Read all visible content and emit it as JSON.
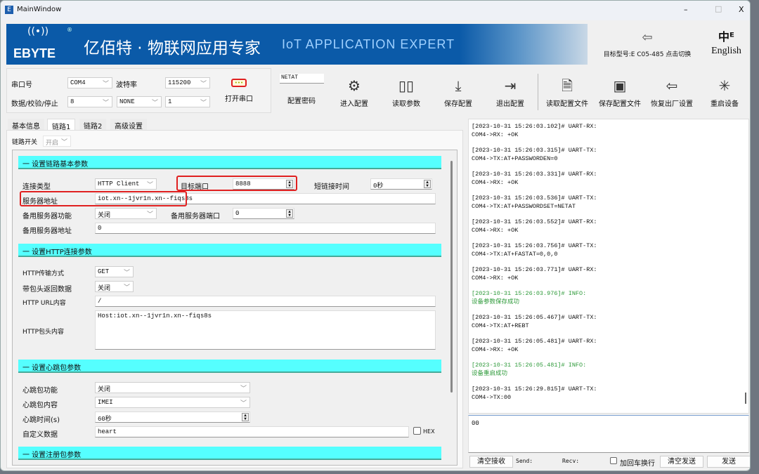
{
  "window": {
    "title": "MainWindow",
    "app_icon": "E",
    "minimize": "–",
    "maximize": "□",
    "close": "X"
  },
  "banner": {
    "logo": "EBYTE",
    "logo_mark": "®",
    "slogan_cn": "亿佰特 · 物联网应用专家",
    "slogan_en": "IoT APPLICATION EXPERT",
    "model_switch": "目标型号:E C05-485 点击切换",
    "language": "English"
  },
  "serial": {
    "port_label": "串口号",
    "port": "COM4",
    "baud_label": "波特率",
    "baud": "115200",
    "format_label": "数据/校验/停止",
    "data_bits": "8",
    "parity": "NONE",
    "stop_bits": "1",
    "open_label": "打开串口"
  },
  "toolbar": {
    "password_value": "NETAT",
    "password_label": "配置密码",
    "items": [
      "进入配置",
      "读取参数",
      "保存配置",
      "退出配置",
      "读取配置文件",
      "保存配置文件",
      "恢复出厂设置",
      "重启设备"
    ]
  },
  "tabs": [
    "基本信息",
    "链路1",
    "链路2",
    "高级设置"
  ],
  "link_switch": {
    "label": "链路开关",
    "value": "开启"
  },
  "basic": {
    "title": "一 设置链路基本参数",
    "conn_type_label": "连接类型",
    "conn_type": "HTTP Client",
    "port_label": "目标端口",
    "port": "8888",
    "short_label": "短链接时间",
    "short": "0秒",
    "server_label": "服务器地址",
    "server": "iot.xn--1jvr1n.xn--fiqs8s",
    "backup_func_label": "备用服务器功能",
    "backup_func": "关闭",
    "backup_port_label": "备用服务器端口",
    "backup_port": "0",
    "backup_addr_label": "备用服务器地址",
    "backup_addr": "0"
  },
  "http": {
    "title": "一 设置HTTP连接参数",
    "method_label": "HTTP传输方式",
    "method": "GET",
    "return_label": "带包头返回数据",
    "return": "关闭",
    "url_label": "HTTP URL内容",
    "url": "/",
    "header_label": "HTTP包头内容",
    "header": "Host:iot.xn--1jvr1n.xn--fiqs8s"
  },
  "heartbeat": {
    "title": "一 设置心跳包参数",
    "func_label": "心跳包功能",
    "func": "关闭",
    "content_label": "心跳包内容",
    "content": "IMEI",
    "time_label": "心跳时间(s)",
    "time": "60秒",
    "custom_label": "自定义数据",
    "custom": "heart",
    "hex": "HEX"
  },
  "register": {
    "title": "一 设置注册包参数"
  },
  "log": [
    {
      "h": "[2023-10-31 15:26:03.102]# UART-RX:",
      "b": "COM4->RX: +OK",
      "info": false
    },
    {
      "h": "[2023-10-31 15:26:03.315]# UART-TX:",
      "b": "COM4->TX:AT+PASSWORDEN=0",
      "info": false
    },
    {
      "h": "[2023-10-31 15:26:03.331]# UART-RX:",
      "b": "COM4->RX: +OK",
      "info": false
    },
    {
      "h": "[2023-10-31 15:26:03.536]# UART-TX:",
      "b": "COM4->TX:AT+PASSWORDSET=NETAT",
      "info": false
    },
    {
      "h": "[2023-10-31 15:26:03.552]# UART-RX:",
      "b": "COM4->RX: +OK",
      "info": false
    },
    {
      "h": "[2023-10-31 15:26:03.756]# UART-TX:",
      "b": "COM4->TX:AT+FASTAT=0,0,0",
      "info": false
    },
    {
      "h": "[2023-10-31 15:26:03.771]# UART-RX:",
      "b": "COM4->RX: +OK",
      "info": false
    },
    {
      "h": "[2023-10-31 15:26:03.976]# INFO:",
      "b": "设备参数保存成功",
      "info": true
    },
    {
      "h": "[2023-10-31 15:26:05.467]# UART-TX:",
      "b": "COM4->TX:AT+REBT",
      "info": false
    },
    {
      "h": "[2023-10-31 15:26:05.481]# UART-RX:",
      "b": "COM4->RX: +OK",
      "info": false
    },
    {
      "h": "[2023-10-31 15:26:05.481]# INFO:",
      "b": "设备重启成功",
      "info": true
    },
    {
      "h": "[2023-10-31 15:26:29.815]# UART-TX:",
      "b": "COM4->TX:00",
      "info": false
    }
  ],
  "send": {
    "value": "00",
    "clear_recv": "清空接收",
    "send_label": "Send:",
    "recv_label": "Recv:",
    "crlf": "加回车换行",
    "clear_send": "清空发送",
    "send_btn": "发送"
  }
}
